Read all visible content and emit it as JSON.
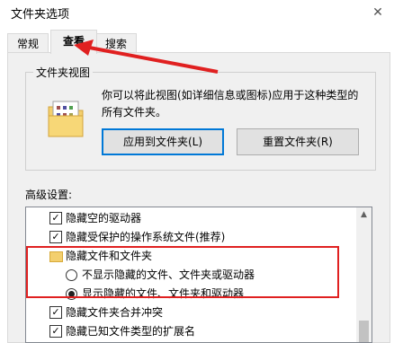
{
  "window": {
    "title": "文件夹选项",
    "close_glyph": "✕"
  },
  "tabs": [
    {
      "label": "常规"
    },
    {
      "label": "查看"
    },
    {
      "label": "搜索"
    }
  ],
  "folder_views": {
    "label": "文件夹视图",
    "description": "你可以将此视图(如详细信息或图标)应用于这种类型的所有文件夹。",
    "apply_button": "应用到文件夹(L)",
    "reset_button": "重置文件夹(R)"
  },
  "advanced": {
    "label": "高级设置:",
    "items": [
      {
        "label": "隐藏空的驱动器",
        "checked": true
      },
      {
        "label": "隐藏受保护的操作系统文件(推荐)",
        "checked": true
      },
      {
        "label": "隐藏文件和文件夹"
      },
      {
        "label": "不显示隐藏的文件、文件夹或驱动器",
        "selected": false
      },
      {
        "label": "显示隐藏的文件、文件夹和驱动器",
        "selected": true
      },
      {
        "label": "隐藏文件夹合并冲突",
        "checked": true
      },
      {
        "label": "隐藏已知文件类型的扩展名",
        "checked": true
      }
    ]
  },
  "colors": {
    "annotation": "#e02020",
    "accent": "#0078d7"
  }
}
